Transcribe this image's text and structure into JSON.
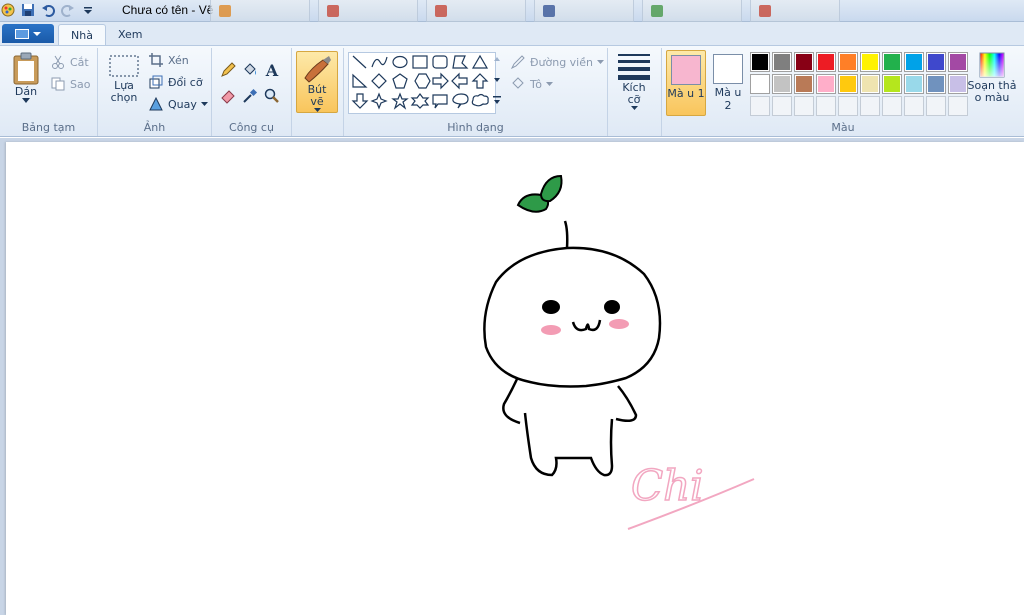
{
  "window": {
    "title": "Chưa có tên - Vẽ"
  },
  "ribbon": {
    "tabs": [
      {
        "label": "Nhà",
        "active": true
      },
      {
        "label": "Xem",
        "active": false
      }
    ],
    "clipboard": {
      "paste_label": "Dán",
      "cut_label": "Cắt",
      "copy_label": "Sao",
      "group_label": "Bảng tạm"
    },
    "image": {
      "select_label": "Lựa chọn",
      "crop_label": "Xén",
      "resize_label": "Đổi cỡ",
      "rotate_label": "Quay",
      "group_label": "Ảnh"
    },
    "tools": {
      "group_label": "Công cụ"
    },
    "brushes": {
      "label": "Bút vẽ"
    },
    "shapes": {
      "outline_label": "Đường viền",
      "fill_label": "Tô",
      "group_label": "Hình dạng"
    },
    "size": {
      "label": "Kích cỡ"
    },
    "colors": {
      "color1_label": "Mà u 1",
      "color2_label": "Mà u 2",
      "color1_value": "#f7b6cf",
      "color2_value": "#ffffff",
      "edit_label": "Soạn thả o màu",
      "group_label": "Màu",
      "palette_row1": [
        "#000000",
        "#7f7f7f",
        "#880015",
        "#ed1c24",
        "#ff7f27",
        "#fff200",
        "#22b14c",
        "#00a2e8",
        "#3f48cc",
        "#a349a4"
      ],
      "palette_row2": [
        "#ffffff",
        "#c3c3c3",
        "#b97a57",
        "#ffaec9",
        "#ffc90e",
        "#efe4b0",
        "#b5e61d",
        "#99d9ea",
        "#7092be",
        "#c8bfe7"
      ]
    }
  },
  "canvas": {
    "signature_text": "Chi"
  }
}
